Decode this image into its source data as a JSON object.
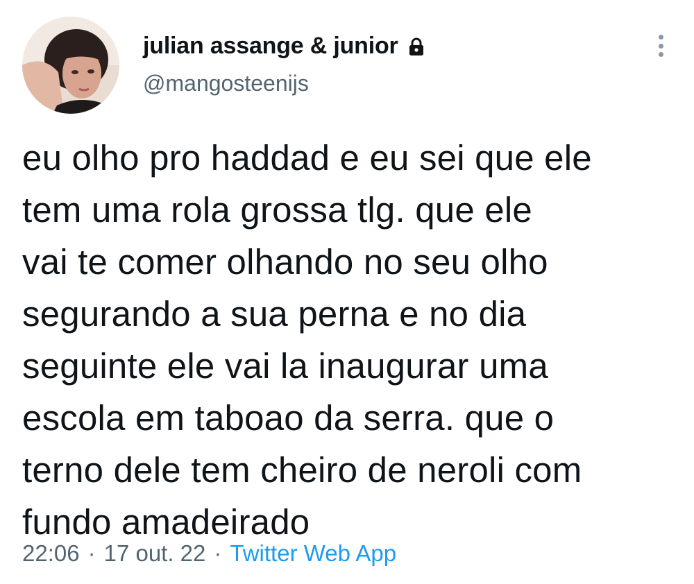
{
  "tweet": {
    "display_name": "julian assange & junior",
    "handle": "@mangosteenijs",
    "locked_icon": "lock-icon",
    "more_icon": "vertical-ellipsis-icon",
    "text": "eu olho pro haddad e eu sei que ele\ntem uma rola grossa tlg. que ele\nvai te comer olhando no seu olho\nsegurando a sua perna e no dia\nseguinte ele vai la inaugurar uma\nescola em taboao da serra. que o\nterno dele tem cheiro de neroli com\nfundo amadeirado",
    "time": "22:06",
    "date": "17 out. 22",
    "separator": "·",
    "source": "Twitter Web App"
  },
  "colors": {
    "text": "#0f1419",
    "secondary": "#536471",
    "link": "#1d9bf0",
    "background": "#ffffff"
  }
}
